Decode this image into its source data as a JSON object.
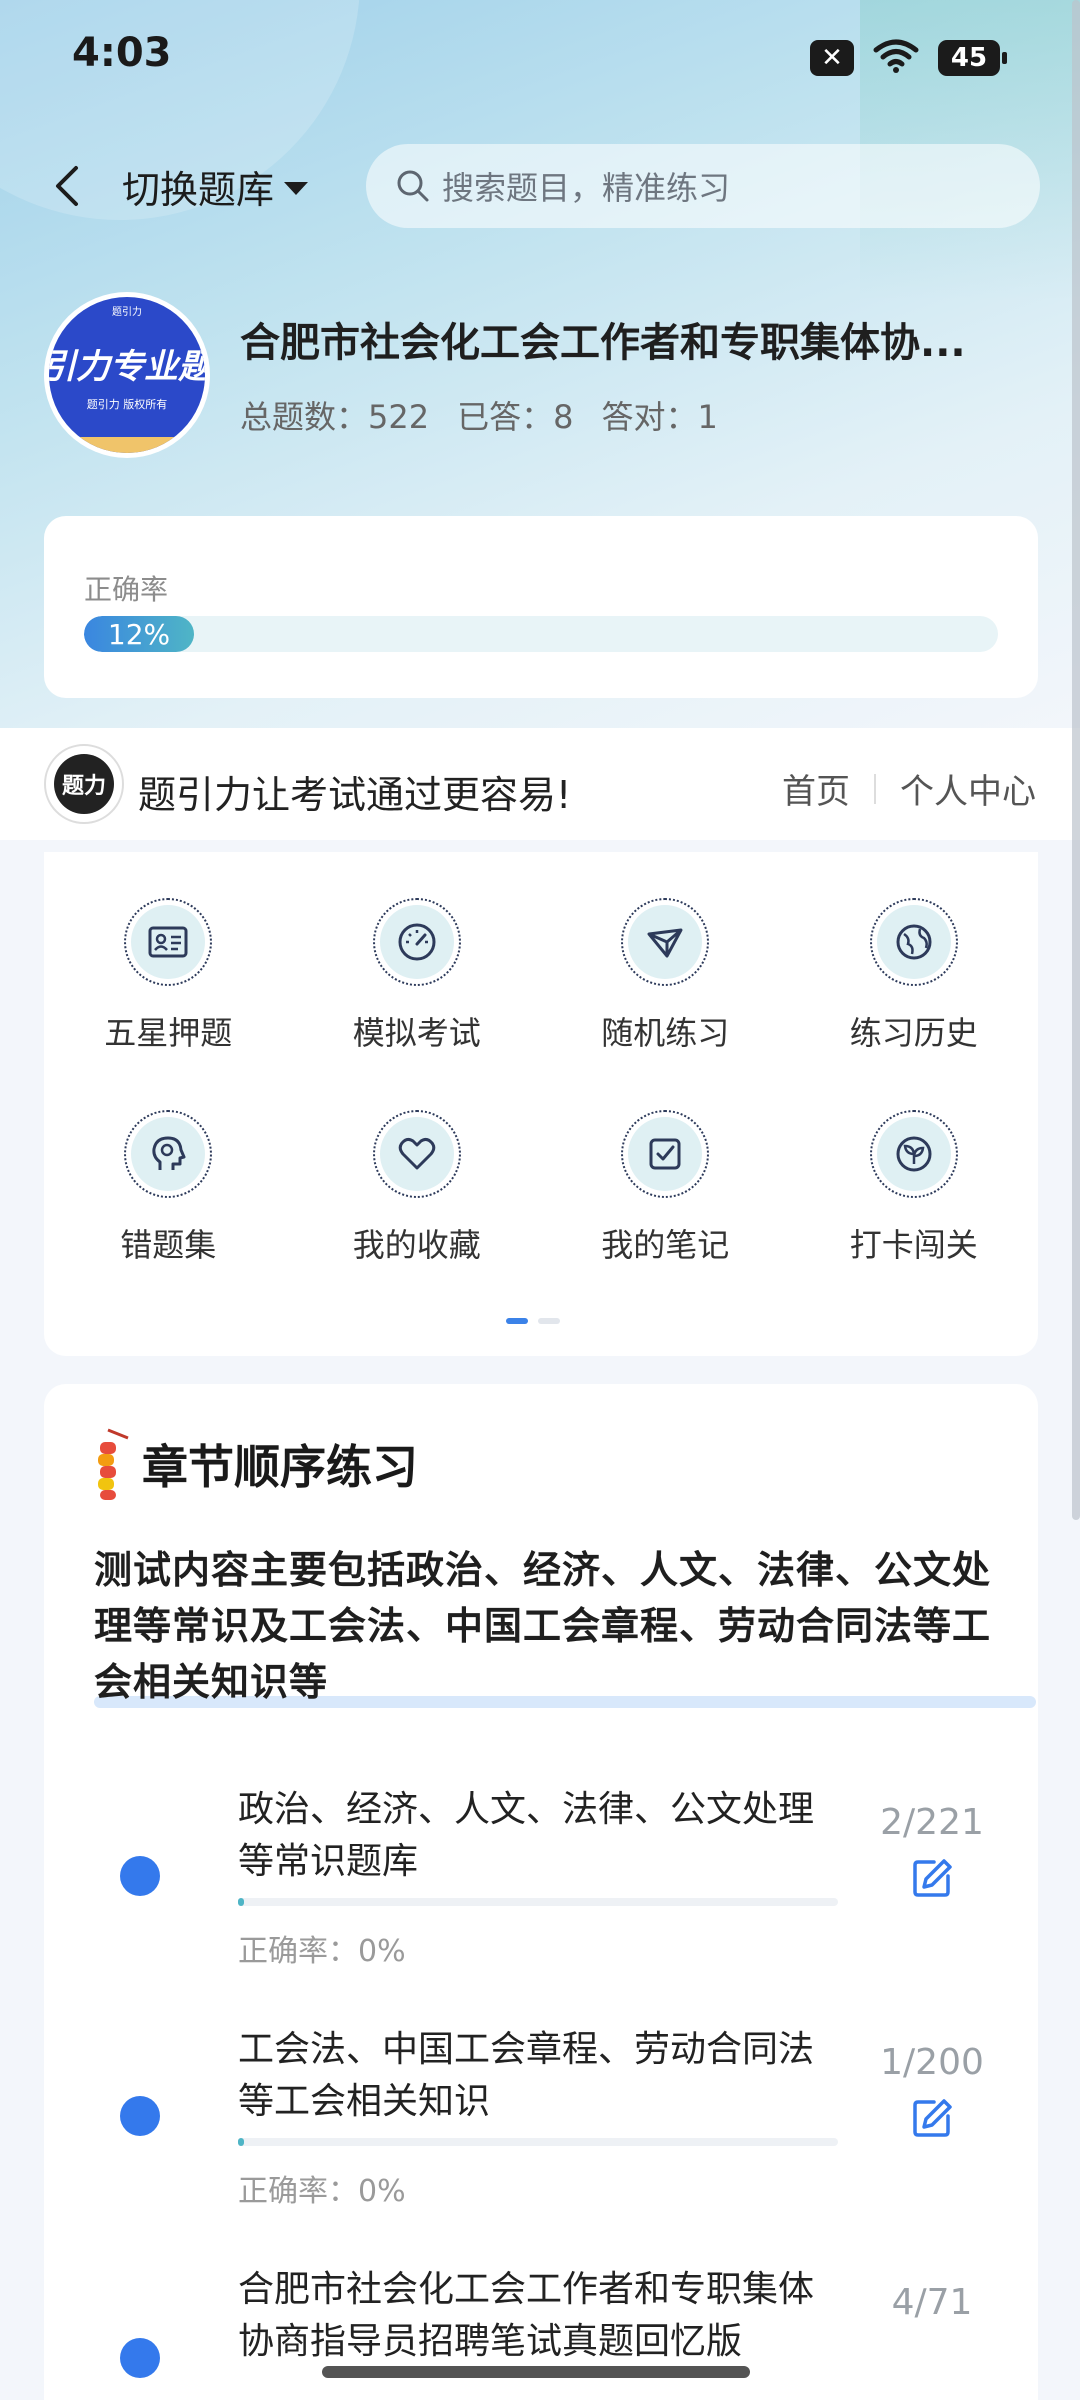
{
  "status_bar": {
    "time": "4:03",
    "sim_label": "✕",
    "battery": "45"
  },
  "header": {
    "switch_bank_label": "切换题库",
    "search_placeholder": "搜索题目，精准练习"
  },
  "bank": {
    "logo_text": "引力专业题",
    "logo_small": "题引力 版权所有",
    "logo_top": "题引力",
    "title": "合肥市社会化工会工作者和专职集体协...",
    "total_label": "总题数：522",
    "answered_label": "已答：8",
    "correct_label": "答对：1"
  },
  "accuracy": {
    "label": "正确率",
    "percent_text": "12%",
    "value": 0.12
  },
  "banner": {
    "logo_text": "题力",
    "slogan": "题引力让考试通过更容易!",
    "link_home": "首页",
    "link_profile": "个人中心"
  },
  "features": [
    {
      "label": "五星押题",
      "icon": "id-card-icon"
    },
    {
      "label": "模拟考试",
      "icon": "speedometer-icon"
    },
    {
      "label": "随机练习",
      "icon": "network-icon"
    },
    {
      "label": "练习历史",
      "icon": "globe-icon"
    },
    {
      "label": "错题集",
      "icon": "head-icon"
    },
    {
      "label": "我的收藏",
      "icon": "heart-icon"
    },
    {
      "label": "我的笔记",
      "icon": "note-check-icon"
    },
    {
      "label": "打卡闯关",
      "icon": "sprout-icon"
    }
  ],
  "chapter_section": {
    "title": "章节顺序练习",
    "description": "测试内容主要包括政治、经济、人文、法律、公文处理等常识及工会法、中国工会章程、劳动合同法等工会相关知识等",
    "items": [
      {
        "name": "政治、经济、人文、法律、公文处理等常识题库",
        "count": "2/221",
        "accuracy": "正确率：0%",
        "progress": 0.009
      },
      {
        "name": "工会法、中国工会章程、劳动合同法等工会相关知识",
        "count": "1/200",
        "accuracy": "正确率：0%",
        "progress": 0.005
      },
      {
        "name": "合肥市社会化工会工作者和专职集体协商指导员招聘笔试真题回忆版",
        "count": "4/71",
        "accuracy": "",
        "progress": 0.056
      }
    ]
  },
  "colors": {
    "accent": "#3479ec",
    "progress": "#4fb5c6",
    "brand_blue": "#2b49c9"
  }
}
